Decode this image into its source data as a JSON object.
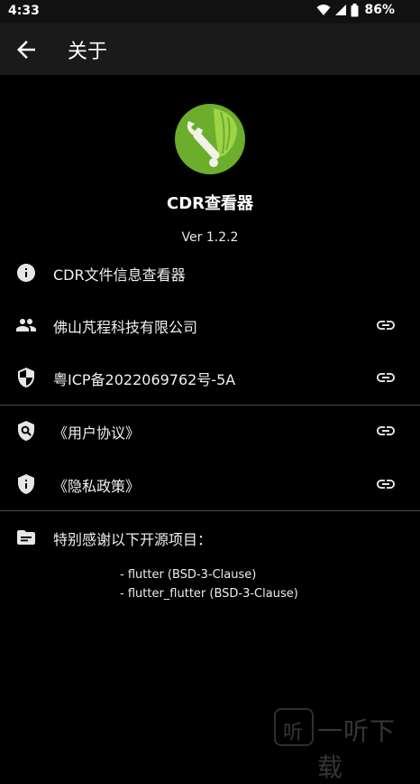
{
  "status": {
    "time": "4:33",
    "battery": "86%"
  },
  "header": {
    "title": "关于"
  },
  "app": {
    "name": "CDR查看器",
    "version": "Ver 1.2.2"
  },
  "items": [
    {
      "label": "CDR文件信息查看器",
      "icon": "info-icon",
      "link": false
    },
    {
      "label": "佛山芃程科技有限公司",
      "icon": "people-icon",
      "link": true
    },
    {
      "label": "粤ICP备2022069762号-5A",
      "icon": "shield-icon",
      "link": true
    },
    {
      "label": "《用户协议》",
      "icon": "policy-icon",
      "link": true
    },
    {
      "label": "《隐私政策》",
      "icon": "privacy-icon",
      "link": true
    },
    {
      "label": "特别感谢以下开源项目：",
      "icon": "folder-icon",
      "link": false
    }
  ],
  "credits": [
    "- flutter (BSD-3-Clause)",
    "- flutter_flutter (BSD-3-Clause)"
  ],
  "watermark": {
    "box": "听",
    "text": "一听下载"
  },
  "colors": {
    "background": "#000000",
    "appbar": "#1a1a1a",
    "logo_green": "#6cae2b",
    "divider": "#4a4a4a"
  }
}
